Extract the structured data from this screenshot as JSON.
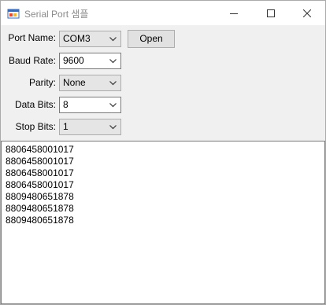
{
  "window": {
    "title": "Serial Port 샘플"
  },
  "form": {
    "port_name": {
      "label": "Port Name:",
      "value": "COM3"
    },
    "open_button": "Open",
    "baud_rate": {
      "label": "Baud Rate:",
      "value": "9600"
    },
    "parity": {
      "label": "Parity:",
      "value": "None"
    },
    "data_bits": {
      "label": "Data Bits:",
      "value": "8"
    },
    "stop_bits": {
      "label": "Stop Bits:",
      "value": "1"
    }
  },
  "output": {
    "lines": [
      "8806458001017",
      "8806458001017",
      "8806458001017",
      "8806458001017",
      "8809480651878",
      "8809480651878",
      "8809480651878"
    ]
  }
}
